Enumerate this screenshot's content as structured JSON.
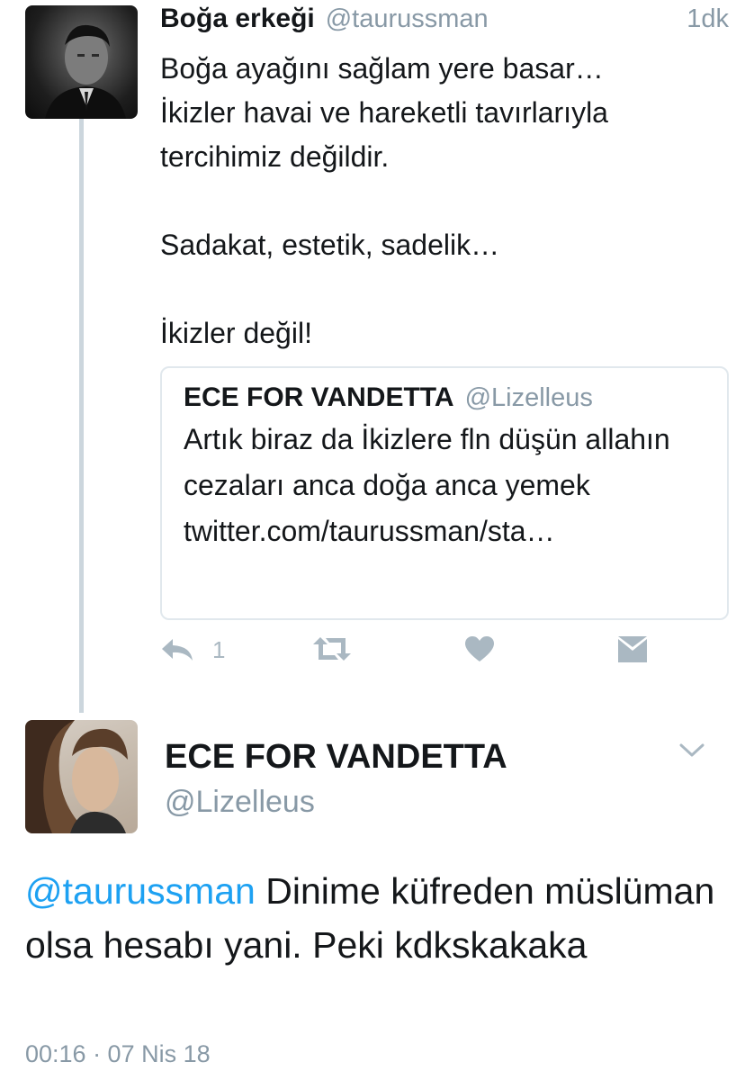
{
  "reply_tweet": {
    "name": "Boğa erkeği",
    "handle": "@taurussman",
    "time": "1dk",
    "text": "Boğa ayağını sağlam yere basar…\nİkizler havai ve hareketli tavırlarıyla tercihimiz değildir.\n\nSadakat, estetik, sadelik…\n\nİkizler değil!",
    "quoted": {
      "name": "ECE FOR VANDETTA",
      "handle": "@Lizelleus",
      "text": "Artık biraz da İkizlere fln düşün allahın cezaları anca doğa anca yemek twitter.com/taurussman/sta…"
    },
    "actions": {
      "reply_icon": "reply-icon",
      "reply_count": "1",
      "retweet_icon": "retweet-icon",
      "like_icon": "heart-icon",
      "dm_icon": "envelope-icon"
    }
  },
  "main_tweet": {
    "name": "ECE FOR VANDETTA",
    "handle": "@Lizelleus",
    "menu_icon": "chevron-down-icon",
    "mention": "@taurussman",
    "text": " Dinime küfreden müslüman olsa hesabı yani. Peki kdkskakaka",
    "meta": "00:16 · 07 Nis 18"
  },
  "colors": {
    "link": "#1da1f2",
    "muted": "#8899a6",
    "icon": "#aab8c2",
    "thread_line": "#ccd6dd",
    "border": "#e1e8ed"
  }
}
